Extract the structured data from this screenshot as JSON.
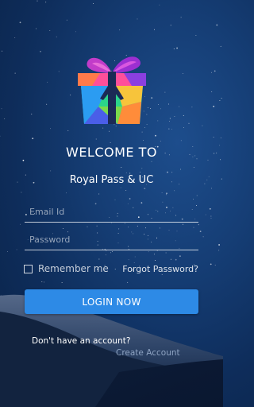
{
  "header": {
    "welcome_text": "WELCOME TO",
    "app_name": "Royal Pass & UC"
  },
  "form": {
    "email_placeholder": "Email Id",
    "email_value": "",
    "password_placeholder": "Password",
    "password_value": "",
    "remember_label": "Remember me",
    "remember_checked": false,
    "forgot_label": "Forgot Password?"
  },
  "actions": {
    "login_label": "LOGIN NOW",
    "no_account_text": "Don't have an account?",
    "create_account_label": "Create Account"
  },
  "colors": {
    "accent": "#2d8ae6",
    "background": "#153d74"
  },
  "icons": {
    "logo": "gift-box-icon",
    "checkbox": "checkbox-icon"
  }
}
